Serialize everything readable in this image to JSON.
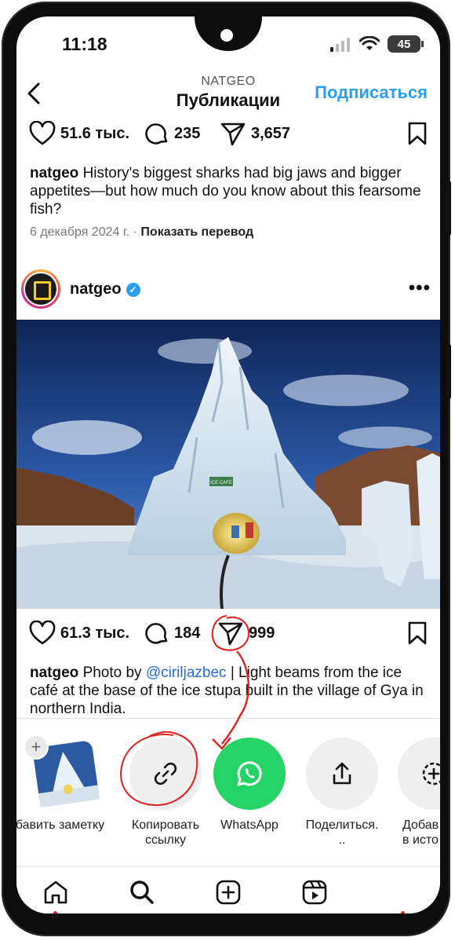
{
  "status_bar": {
    "time": "11:18",
    "battery": "45"
  },
  "header": {
    "subtitle": "NATGEO",
    "title": "Публикации",
    "follow_label": "Подписаться"
  },
  "prev_post": {
    "likes": "51.6 тыс.",
    "comments": "235",
    "shares": "3,657",
    "caption_user": "natgeo",
    "caption_text": "History's biggest sharks had big jaws and bigger appetites—but how much do you know about this fearsome fish?",
    "date": "6 декабря 2024 г.",
    "separator": "·",
    "translate_label": "Показать перевод"
  },
  "post": {
    "username": "natgeo",
    "photo_sign": "ICE CAFE",
    "likes": "61.3 тыс.",
    "comments": "184",
    "shares": "999",
    "caption_user": "natgeo",
    "caption_prefix": "Photo by",
    "caption_mention": "@ciriljazbec",
    "caption_rest": "| Light beams from the ice café at the base of the ice stupa built in the village of Gya in northern India."
  },
  "share_sheet": {
    "items": [
      {
        "label": "обавить заметку"
      },
      {
        "label": "Копировать\nссылку"
      },
      {
        "label": "WhatsApp"
      },
      {
        "label": "Поделиться.\n.."
      },
      {
        "label": "Добав\nв исто"
      }
    ]
  },
  "colors": {
    "accent": "#2a9df4",
    "whatsapp": "#25d366",
    "annotation": "#e0201c"
  }
}
